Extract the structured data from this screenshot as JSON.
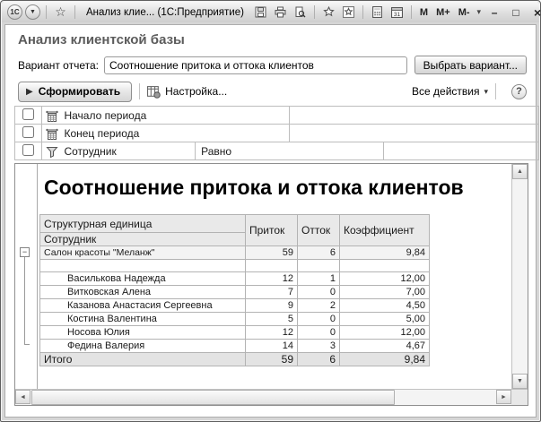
{
  "titlebar": {
    "title": "Анализ клие... (1С:Предприятие)",
    "logo": "1С",
    "memory": [
      "M",
      "M+",
      "M-"
    ]
  },
  "icons": {
    "play": "▶",
    "star": "☆",
    "titlebar_dropdown": "▼",
    "chevron_down": "▾",
    "minimize": "–",
    "maximize": "□",
    "close": "×",
    "collapse": "−",
    "scroll_up": "▲",
    "scroll_down": "▼",
    "scroll_left": "◄",
    "scroll_right": "►"
  },
  "header": {
    "page_title": "Анализ клиентской базы",
    "variant_label": "Вариант отчета:",
    "variant_value": "Соотношение притока и оттока клиентов",
    "choose_variant_button": "Выбрать вариант..."
  },
  "toolbar": {
    "generate_label": "Сформировать",
    "settings_label": "Настройка...",
    "all_actions_label": "Все действия",
    "help_label": "?"
  },
  "filters": {
    "rows": [
      {
        "label": "Начало периода",
        "condition": "",
        "value": ""
      },
      {
        "label": "Конец периода",
        "condition": "",
        "value": ""
      },
      {
        "label": "Сотрудник",
        "condition": "Равно",
        "value": ""
      }
    ]
  },
  "report": {
    "title": "Соотношение притока и оттока клиентов",
    "columns": [
      "Структурная единица",
      "Приток",
      "Отток",
      "Коэффициент"
    ],
    "group_label": "Сотрудник",
    "group_row": {
      "name": "Салон красоты \"Меланж\"",
      "inflow": "59",
      "outflow": "6",
      "ratio": "9,84"
    },
    "rows": [
      {
        "name": "Василькова Надежда",
        "inflow": "12",
        "outflow": "1",
        "ratio": "12,00"
      },
      {
        "name": "Витковская Алена",
        "inflow": "7",
        "outflow": "0",
        "ratio": "7,00"
      },
      {
        "name": "Казанова Анастасия Сергеевна",
        "inflow": "9",
        "outflow": "2",
        "ratio": "4,50"
      },
      {
        "name": "Костина Валентина",
        "inflow": "5",
        "outflow": "0",
        "ratio": "5,00"
      },
      {
        "name": "Носова Юлия",
        "inflow": "12",
        "outflow": "0",
        "ratio": "12,00"
      },
      {
        "name": "Федина Валерия",
        "inflow": "14",
        "outflow": "3",
        "ratio": "4,67"
      }
    ],
    "total_row": {
      "name": "Итого",
      "inflow": "59",
      "outflow": "6",
      "ratio": "9,84"
    }
  },
  "colors": {
    "header_bg": "#e9e9e9",
    "group_row_bg": "#f3f3f3",
    "total_row_bg": "#e3e3e3",
    "titlebar_top": "#f7f7f7",
    "titlebar_bottom": "#cfcfcf"
  }
}
